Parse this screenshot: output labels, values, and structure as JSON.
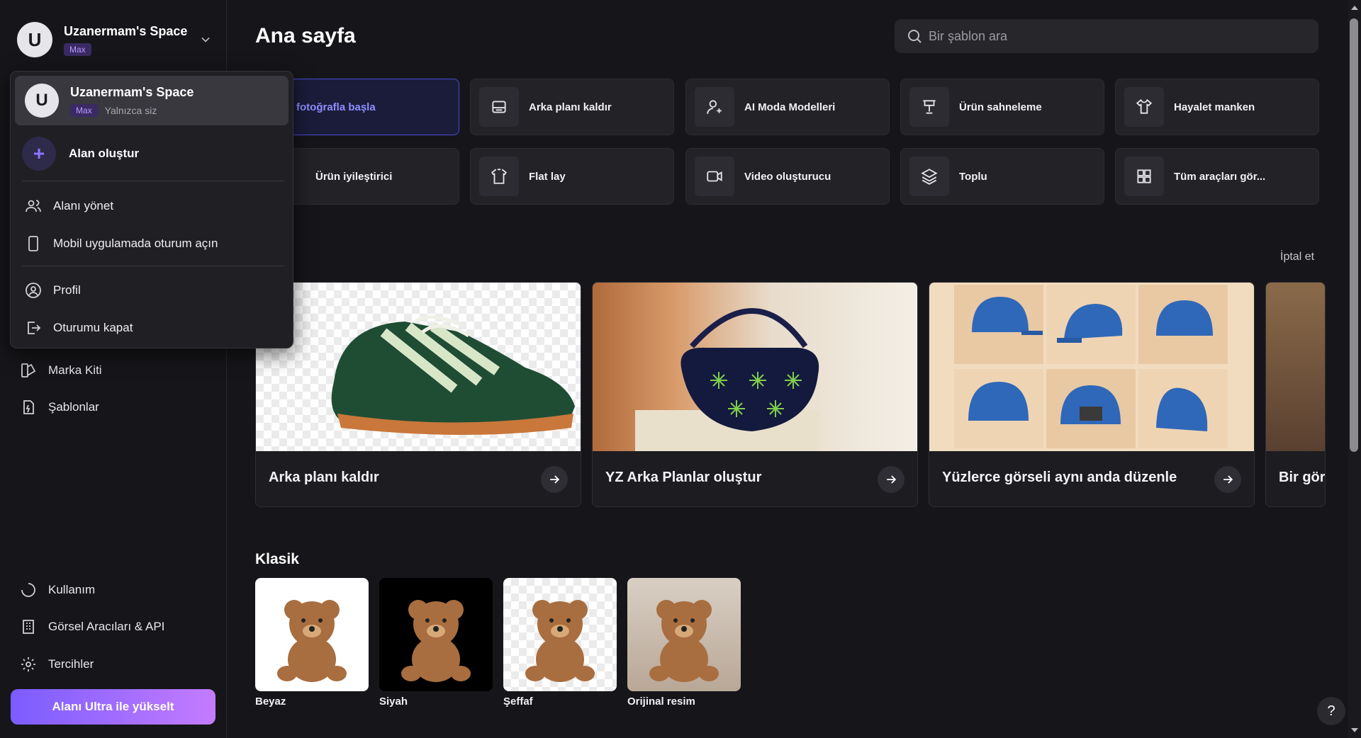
{
  "space": {
    "avatar_letter": "U",
    "name": "Uzanermam's Space",
    "plan": "Max"
  },
  "dropdown": {
    "current_name": "Uzanermam's Space",
    "current_plan": "Max",
    "current_sub": "Yalnızca siz",
    "create_label": "Alan oluştur",
    "items": [
      {
        "label": "Alanı yönet",
        "icon": "users-icon"
      },
      {
        "label": "Mobil uygulamada oturum açın",
        "icon": "phone-icon"
      },
      {
        "label": "Profil",
        "icon": "profile-icon"
      },
      {
        "label": "Oturumu kapat",
        "icon": "logout-icon"
      }
    ]
  },
  "sidebar": {
    "nav": [
      {
        "label": "Marka Kiti",
        "icon": "brand-kit-icon"
      },
      {
        "label": "Şablonlar",
        "icon": "templates-icon"
      }
    ],
    "bottom": [
      {
        "label": "Kullanım",
        "icon": "usage-icon"
      },
      {
        "label": "Görsel Aracıları & API",
        "icon": "building-icon"
      },
      {
        "label": "Tercihler",
        "icon": "gear-icon"
      }
    ],
    "upgrade_label": "Alanı Ultra ile yükselt"
  },
  "main": {
    "title": "Ana sayfa",
    "search_placeholder": "Bir şablon ara",
    "tools": [
      {
        "label": "Bir fotoğrafla başla",
        "icon": "",
        "active": true
      },
      {
        "label": "Arka planı kaldır",
        "icon": "eraser-icon"
      },
      {
        "label": "AI Moda Modelleri",
        "icon": "model-icon"
      },
      {
        "label": "Ürün sahneleme",
        "icon": "staging-icon"
      },
      {
        "label": "Hayalet manken",
        "icon": "shirt-icon"
      },
      {
        "label": "Ürün iyileştirici",
        "icon": ""
      },
      {
        "label": "Flat lay",
        "icon": "flatlay-icon"
      },
      {
        "label": "Video oluşturucu",
        "icon": "video-icon"
      },
      {
        "label": "Toplu",
        "icon": "layers-icon"
      },
      {
        "label": "Tüm araçları gör...",
        "icon": "grid-icon"
      }
    ],
    "cancel_label": "İptal et",
    "cards": [
      {
        "label": "Arka planı kaldır"
      },
      {
        "label": "YZ Arka Planlar oluştur"
      },
      {
        "label": "Yüzlerce görseli aynı anda düzenle"
      },
      {
        "label": "Bir görs"
      }
    ],
    "classic_title": "Klasik",
    "classic": [
      {
        "label": "Beyaz"
      },
      {
        "label": "Siyah"
      },
      {
        "label": "Şeffaf"
      },
      {
        "label": "Orijinal resim"
      }
    ]
  },
  "help_label": "?",
  "colors": {
    "accent": "#7b5cff",
    "background": "#16161a"
  }
}
